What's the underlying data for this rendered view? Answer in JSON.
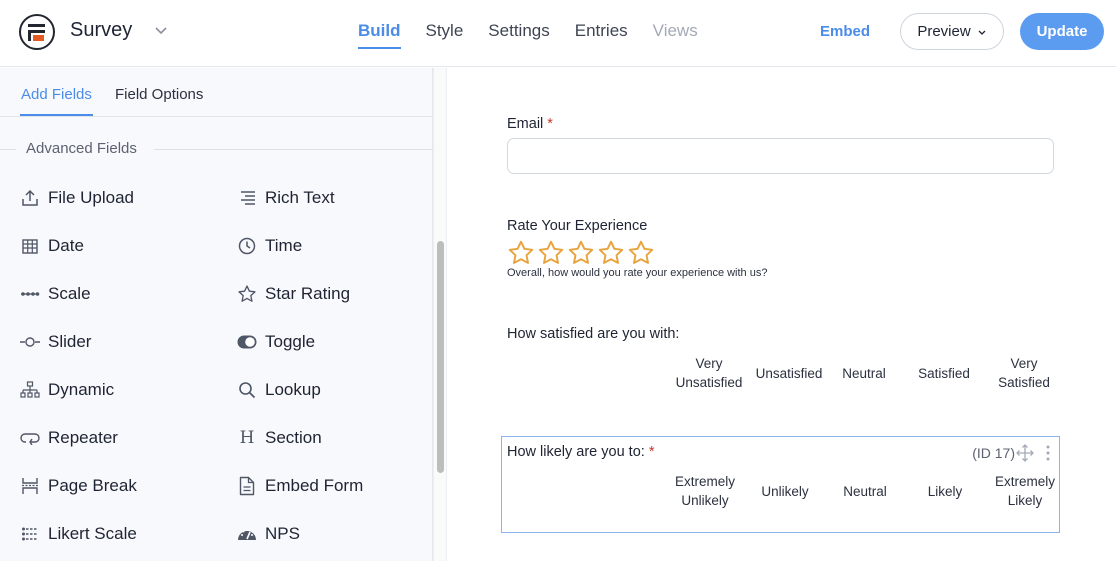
{
  "header": {
    "form_title": "Survey",
    "nav": [
      {
        "label": "Build",
        "state": "active"
      },
      {
        "label": "Style",
        "state": "normal"
      },
      {
        "label": "Settings",
        "state": "normal"
      },
      {
        "label": "Entries",
        "state": "normal"
      },
      {
        "label": "Views",
        "state": "disabled"
      }
    ],
    "embed_label": "Embed",
    "preview_label": "Preview",
    "update_label": "Update"
  },
  "sidebar": {
    "tabs": [
      {
        "label": "Add Fields",
        "active": true
      },
      {
        "label": "Field Options",
        "active": false
      }
    ],
    "section_title": "Advanced Fields",
    "fields": [
      {
        "label": "File Upload",
        "icon": "upload-icon"
      },
      {
        "label": "Rich Text",
        "icon": "rich-text-icon"
      },
      {
        "label": "Date",
        "icon": "calendar-icon"
      },
      {
        "label": "Time",
        "icon": "clock-icon"
      },
      {
        "label": "Scale",
        "icon": "scale-icon"
      },
      {
        "label": "Star Rating",
        "icon": "star-icon"
      },
      {
        "label": "Slider",
        "icon": "slider-icon"
      },
      {
        "label": "Toggle",
        "icon": "toggle-icon"
      },
      {
        "label": "Dynamic",
        "icon": "sitemap-icon"
      },
      {
        "label": "Lookup",
        "icon": "search-icon"
      },
      {
        "label": "Repeater",
        "icon": "repeat-icon"
      },
      {
        "label": "Section",
        "icon": "heading-icon"
      },
      {
        "label": "Page Break",
        "icon": "page-break-icon"
      },
      {
        "label": "Embed Form",
        "icon": "document-icon"
      },
      {
        "label": "Likert Scale",
        "icon": "likert-icon"
      },
      {
        "label": "NPS",
        "icon": "gauge-icon"
      }
    ]
  },
  "form": {
    "email": {
      "label": "Email",
      "required_mark": "*",
      "value": ""
    },
    "rating": {
      "label": "Rate Your Experience",
      "stars_total": 5,
      "stars_filled": 0,
      "star_color": "#e8a33d",
      "description": "Overall, how would you rate your experience with us?"
    },
    "satisfaction": {
      "label": "How satisfied are you with:",
      "columns": [
        [
          "Very",
          "Unsatisfied"
        ],
        [
          "Unsatisfied"
        ],
        [
          "Neutral"
        ],
        [
          "Satisfied"
        ],
        [
          "Very",
          "Satisfied"
        ]
      ]
    },
    "likelihood": {
      "label": "How likely are you to:",
      "required_mark": "*",
      "field_id": "(ID 17)",
      "columns": [
        [
          "Extremely",
          "Unlikely"
        ],
        [
          "Unlikely"
        ],
        [
          "Neutral"
        ],
        [
          "Likely"
        ],
        [
          "Extremely",
          "Likely"
        ]
      ]
    }
  },
  "colors": {
    "accent": "#4a8ce8",
    "update_button": "#5b9cf0",
    "required": "#c0392b"
  }
}
